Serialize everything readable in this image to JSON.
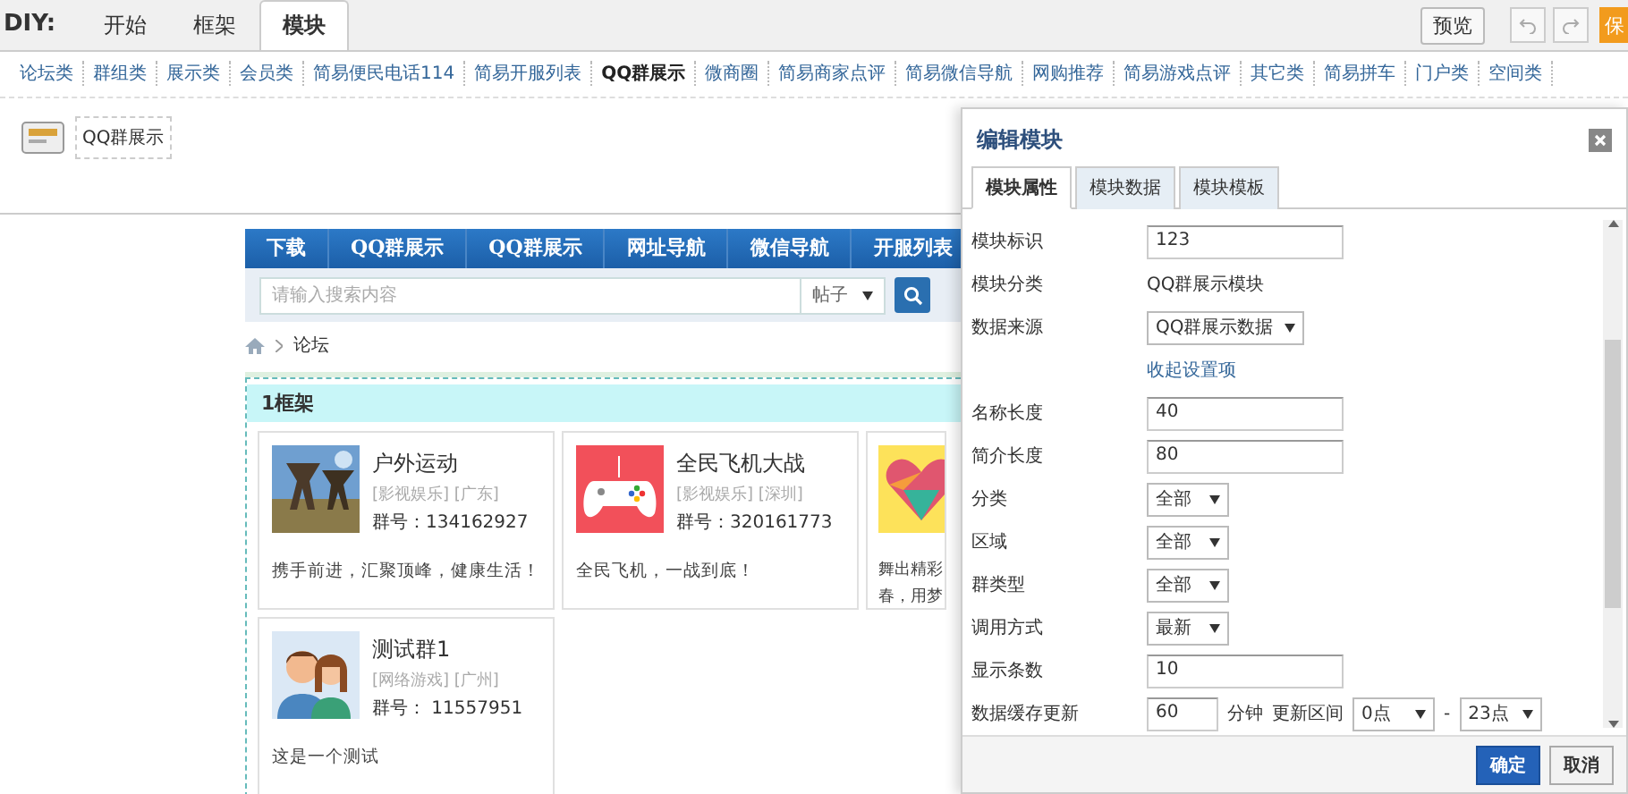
{
  "diy_bar": {
    "label": "DIY:",
    "tabs": [
      {
        "label": "开始",
        "selected": false
      },
      {
        "label": "框架",
        "selected": false
      },
      {
        "label": "模块",
        "selected": true
      }
    ],
    "preview_button": "预览",
    "save_button": "保"
  },
  "categories": [
    {
      "label": "论坛类",
      "selected": false
    },
    {
      "label": "群组类",
      "selected": false
    },
    {
      "label": "展示类",
      "selected": false
    },
    {
      "label": "会员类",
      "selected": false
    },
    {
      "label": "简易便民电话114",
      "selected": false
    },
    {
      "label": "简易开服列表",
      "selected": false
    },
    {
      "label": "QQ群展示",
      "selected": true
    },
    {
      "label": "微商圈",
      "selected": false
    },
    {
      "label": "简易商家点评",
      "selected": false
    },
    {
      "label": "简易微信导航",
      "selected": false
    },
    {
      "label": "网购推荐",
      "selected": false
    },
    {
      "label": "简易游戏点评",
      "selected": false
    },
    {
      "label": "其它类",
      "selected": false
    },
    {
      "label": "简易拼车",
      "selected": false
    },
    {
      "label": "门户类",
      "selected": false
    },
    {
      "label": "空间类",
      "selected": false
    }
  ],
  "modules": [
    {
      "label": "QQ群展示"
    }
  ],
  "preview": {
    "nav": [
      "下载",
      "QQ群展示",
      "QQ群展示",
      "网址导航",
      "微信导航",
      "开服列表"
    ],
    "search": {
      "placeholder": "请输入搜索内容",
      "type": "帖子"
    },
    "breadcrumb": "论坛",
    "frame": {
      "title": "1框架",
      "cards": [
        {
          "name": "户外运动",
          "tags": "[影视娱乐] [广东]",
          "number": "群号：134162927",
          "description": [
            "携手前进，汇聚顶峰，健康生活！"
          ]
        },
        {
          "kind": "gamepad",
          "name": "全民飞机大战",
          "tags": "[影视娱乐] [深圳]",
          "number": "群号：320161773",
          "description": [
            "全民飞机，一战到底！"
          ]
        },
        {
          "kind": "heart",
          "description": [
            "舞出精彩",
            "春，用梦"
          ]
        },
        {
          "kind": "people",
          "name": "测试群1",
          "tags": "[网络游戏] [广州]",
          "number": "群号： 11557951",
          "description": [
            "这是一个测试"
          ]
        }
      ]
    }
  },
  "dialog": {
    "title": "编辑模块",
    "tabs": [
      {
        "label": "模块属性",
        "selected": true
      },
      {
        "label": "模块数据",
        "selected": false
      },
      {
        "label": "模块模板",
        "selected": false
      }
    ],
    "fields": [
      {
        "kind": "input",
        "label": "模块标识",
        "value": "123"
      },
      {
        "kind": "text",
        "label": "模块分类",
        "value": "QQ群展示模块"
      },
      {
        "kind": "select",
        "label": "数据来源",
        "value": "QQ群展示数据"
      },
      {
        "kind": "link",
        "value": "收起设置项"
      },
      {
        "kind": "input",
        "label": "名称长度",
        "value": "40"
      },
      {
        "kind": "input",
        "label": "简介长度",
        "value": "80"
      },
      {
        "kind": "select",
        "label": "分类",
        "value": "全部"
      },
      {
        "kind": "select",
        "label": "区域",
        "value": "全部"
      },
      {
        "kind": "select",
        "label": "群类型",
        "value": "全部"
      },
      {
        "kind": "select",
        "label": "调用方式",
        "value": "最新"
      },
      {
        "kind": "input",
        "label": "显示条数",
        "value": "10"
      },
      {
        "kind": "cache",
        "label": "数据缓存更新",
        "value": "60",
        "unit": "分钟",
        "range_label": "更新区间",
        "from": "0点",
        "separator": "-",
        "to": "23点"
      }
    ],
    "ok_button": "确定",
    "cancel_button": "取消"
  }
}
